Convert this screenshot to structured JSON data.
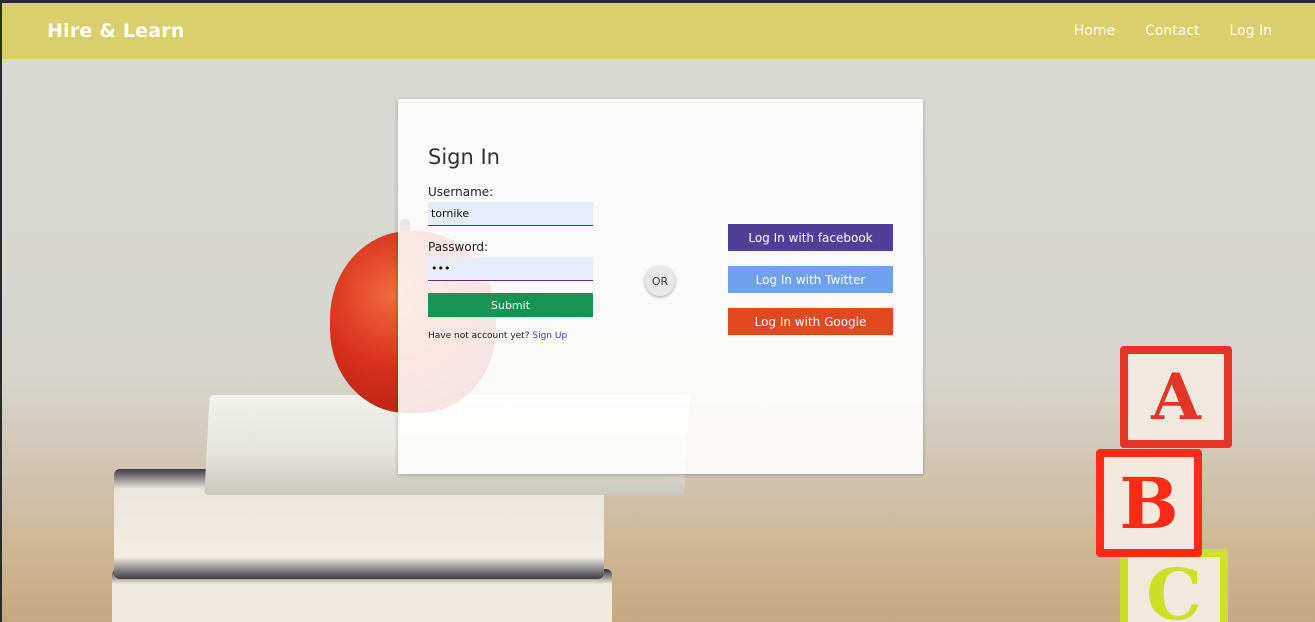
{
  "navbar": {
    "brand": "Hire & Learn",
    "links": [
      "Home",
      "Contact",
      "Log In"
    ]
  },
  "signin": {
    "title": "Sign In",
    "username_label": "Username:",
    "username_value": "tornike",
    "password_label": "Password:",
    "password_value": "•••",
    "submit_label": "Submit",
    "signup_prompt": "Have not account yet?",
    "signup_link": "Sign Up",
    "or_label": "OR"
  },
  "social": {
    "facebook_label": "Log In with facebook",
    "twitter_label": "Log In with Twitter",
    "google_label": "Log In with Google"
  },
  "background": {
    "blocks": [
      "A",
      "B",
      "C"
    ]
  },
  "colors": {
    "navbar": "#dbcf6d",
    "submit": "#179454",
    "facebook": "#4f3f99",
    "twitter": "#6ea2ef",
    "google": "#e2491f",
    "link": "#3a37c9"
  }
}
